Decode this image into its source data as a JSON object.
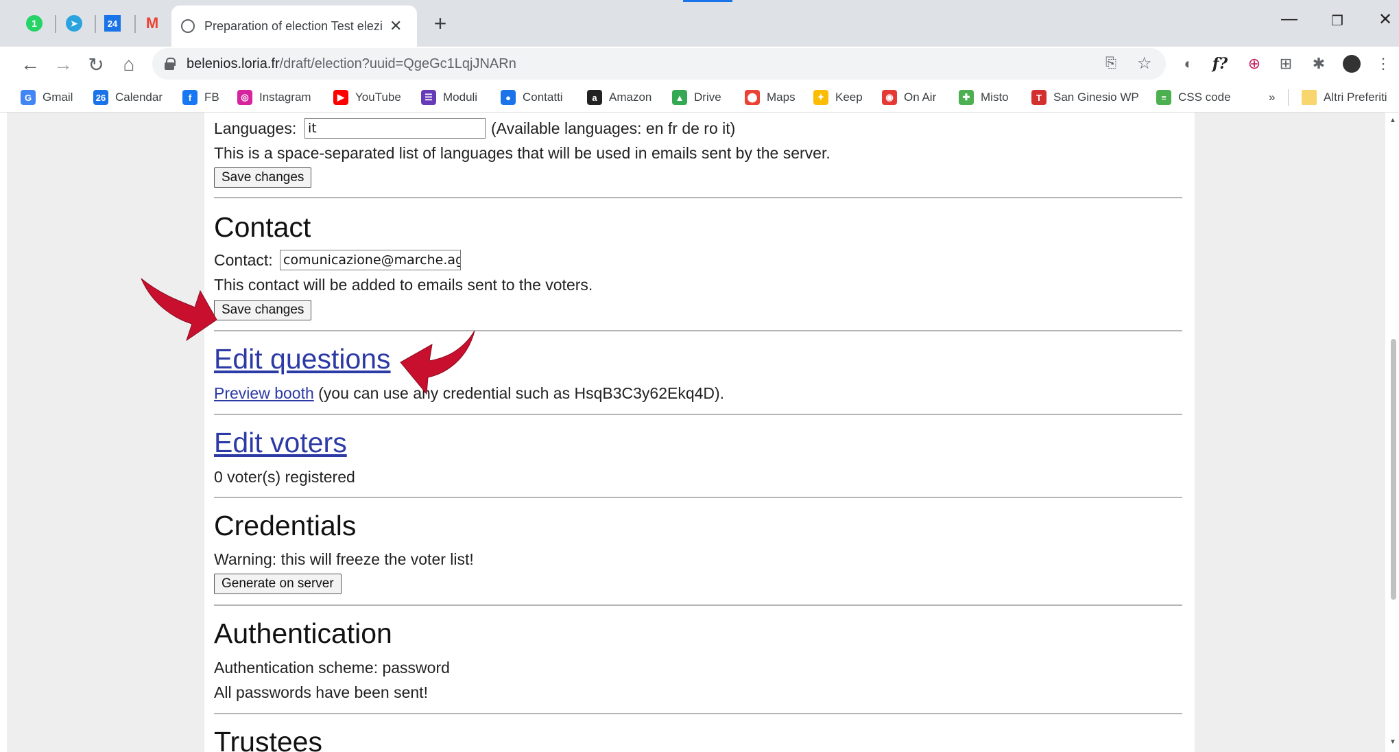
{
  "browser": {
    "pinned_tabs": [
      {
        "name": "whatsapp-tab",
        "badge": "1"
      },
      {
        "name": "telegram-tab",
        "badge": ""
      },
      {
        "name": "calendar-tab",
        "badge": "24"
      },
      {
        "name": "gmail-tab",
        "badge": "M"
      }
    ],
    "active_tab_title": "Preparation of election Test elezio",
    "url_host": "belenios.loria.fr",
    "url_path": "/draft/election?uuid=QgeGc1LqjJNARn",
    "bookmarks": [
      {
        "label": "Gmail",
        "icon": "G",
        "color": "#4285f4"
      },
      {
        "label": "Calendar",
        "icon": "26",
        "color": "#1a73e8"
      },
      {
        "label": "FB",
        "icon": "f",
        "color": "#1877f2"
      },
      {
        "label": "Instagram",
        "icon": "◎",
        "color": "#d6249f"
      },
      {
        "label": "YouTube",
        "icon": "▶",
        "color": "#ff0000"
      },
      {
        "label": "Moduli",
        "icon": "☰",
        "color": "#673ab7"
      },
      {
        "label": "Contatti",
        "icon": "●",
        "color": "#1a73e8"
      },
      {
        "label": "Amazon",
        "icon": "a",
        "color": "#222222"
      },
      {
        "label": "Drive",
        "icon": "▲",
        "color": "#34a853"
      },
      {
        "label": "Maps",
        "icon": "⬤",
        "color": "#ea4335"
      },
      {
        "label": "Keep",
        "icon": "✦",
        "color": "#fbbc04"
      },
      {
        "label": "On Air",
        "icon": "◉",
        "color": "#e53935"
      },
      {
        "label": "Misto",
        "icon": "✚",
        "color": "#4caf50"
      },
      {
        "label": "San Ginesio WP",
        "icon": "T",
        "color": "#d32f2f"
      },
      {
        "label": "CSS code",
        "icon": "≡",
        "color": "#4caf50"
      }
    ],
    "more_bookmarks": "»",
    "other_bookmarks": "Altri Preferiti"
  },
  "page": {
    "languages_label": "Languages:",
    "languages_value": "it",
    "languages_available": "(Available languages: en fr de ro it)",
    "languages_help": "This is a space-separated list of languages that will be used in emails sent by the server.",
    "save_changes_1": "Save changes",
    "contact_heading": "Contact",
    "contact_label": "Contact:",
    "contact_value": "comunicazione@marche.age",
    "contact_help": "This contact will be added to emails sent to the voters.",
    "save_changes_2": "Save changes",
    "edit_questions": "Edit questions",
    "preview_booth": "Preview booth",
    "preview_note": " (you can use any credential such as HsqB3C3y62Ekq4D).",
    "edit_voters": "Edit voters",
    "voters_registered": "0 voter(s) registered",
    "credentials_heading": "Credentials",
    "credentials_warning": "Warning: this will freeze the voter list!",
    "generate_on_server": "Generate on server",
    "authentication_heading": "Authentication",
    "auth_scheme": "Authentication scheme: password",
    "passwords_sent": "All passwords have been sent!",
    "trustees_heading": "Trustees"
  },
  "colors": {
    "link": "#2c3aa5",
    "annotation_arrow": "#c8102e"
  }
}
